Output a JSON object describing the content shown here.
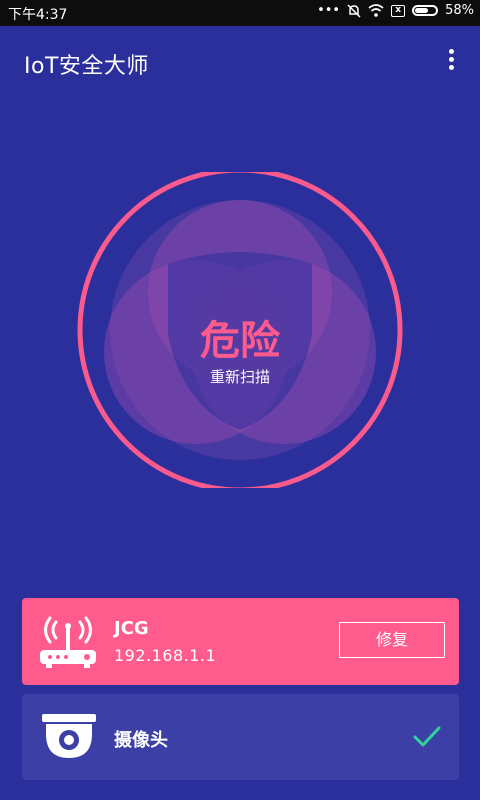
{
  "status_bar": {
    "time": "下午4:37",
    "battery": "58%"
  },
  "app": {
    "title": "IoT安全大师"
  },
  "scan": {
    "status": "危险",
    "rescan_label": "重新扫描",
    "colors": {
      "danger": "#ff5b8d",
      "background": "#2b2f9c"
    }
  },
  "devices": [
    {
      "name": "JCG",
      "ip": "192.168.1.1",
      "action_label": "修复",
      "icon": "router-icon",
      "state": "danger"
    },
    {
      "name": "摄像头",
      "icon": "camera-icon",
      "state": "safe",
      "status_icon": "check-icon"
    }
  ]
}
